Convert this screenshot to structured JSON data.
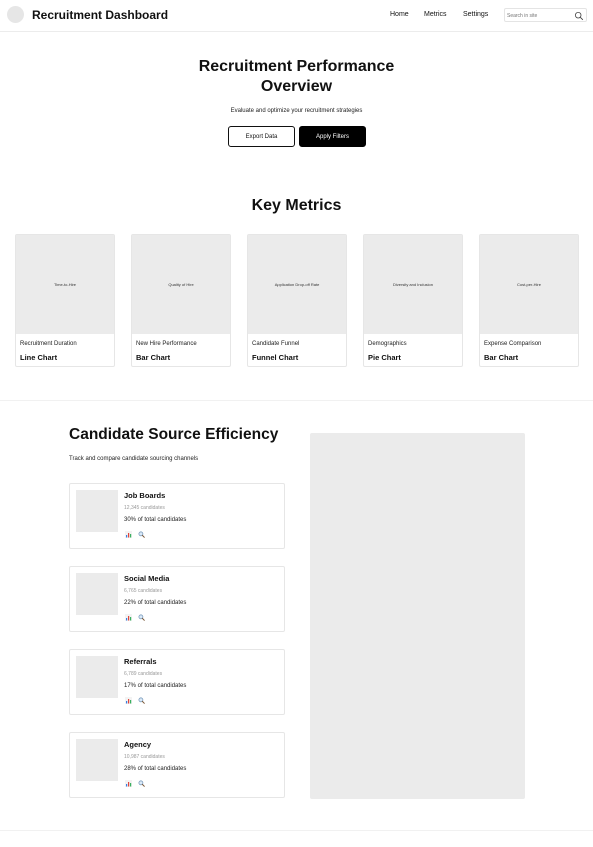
{
  "header": {
    "brand": "Recruitment Dashboard",
    "nav": [
      "Home",
      "Metrics",
      "Settings"
    ],
    "search_placeholder": "Search in site"
  },
  "hero": {
    "title_line1": "Recruitment Performance",
    "title_line2": "Overview",
    "subtitle": "Evaluate and optimize your recruitment strategies",
    "export_label": "Export Data",
    "filters_label": "Apply Filters"
  },
  "metrics": {
    "title": "Key Metrics",
    "cards": [
      {
        "image_label": "Time-to-Hire",
        "subtitle": "Recruitment Duration",
        "chart_type": "Line Chart"
      },
      {
        "image_label": "Quality of Hire",
        "subtitle": "New Hire Performance",
        "chart_type": "Bar Chart"
      },
      {
        "image_label": "Application Drop-off Rate",
        "subtitle": "Candidate Funnel",
        "chart_type": "Funnel Chart"
      },
      {
        "image_label": "Diversity and Inclusion",
        "subtitle": "Demographics",
        "chart_type": "Pie Chart"
      },
      {
        "image_label": "Cost-per-Hire",
        "subtitle": "Expense Comparison",
        "chart_type": "Bar Chart"
      }
    ]
  },
  "sources": {
    "title": "Candidate Source Efficiency",
    "subtitle": "Track and compare candidate sourcing channels",
    "items": [
      {
        "name": "Job Boards",
        "count": "12,345 candidates",
        "share": "30% of total candidates"
      },
      {
        "name": "Social Media",
        "count": "6,765 candidates",
        "share": "22% of total candidates"
      },
      {
        "name": "Referrals",
        "count": "6,789 candidates",
        "share": "17% of total candidates"
      },
      {
        "name": "Agency",
        "count": "10,987 candidates",
        "share": "28% of total candidates"
      }
    ]
  },
  "colors": {
    "accent": "#000000",
    "placeholder": "#ebebeb",
    "border": "#e6e6e6"
  },
  "icons": {
    "search": "search-icon",
    "stats": "bar-chart-icon",
    "magnify": "magnifier-icon"
  }
}
